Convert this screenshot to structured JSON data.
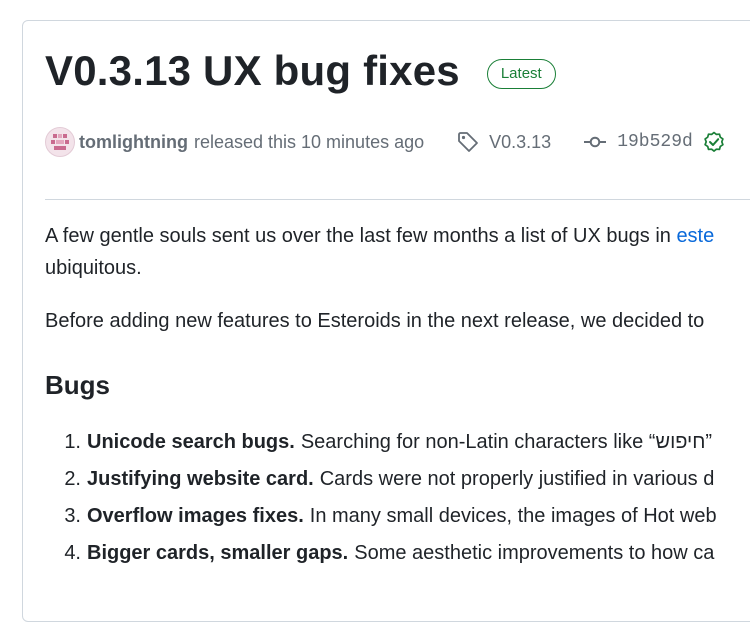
{
  "release": {
    "title": "V0.3.13 UX bug fixes",
    "badge": "Latest",
    "author": "tomlightning",
    "released_text": "released this 10 minutes ago",
    "tag": "V0.3.13",
    "commit_sha": "19b529d",
    "verified_icon": "verified-check-icon",
    "colors": {
      "badge_green": "#1a7f37",
      "link_blue": "#0969da",
      "muted": "#656d76",
      "border": "#d0d7de"
    }
  },
  "body": {
    "paragraph1_start": "A few gentle souls sent us over the last few months a list of UX bugs in ",
    "paragraph1_link": "este",
    "paragraph1_line2": "ubiquitous.",
    "paragraph2": "Before adding new features to Esteroids in the next release, we decided to",
    "bugs_heading": "Bugs",
    "bugs": [
      {
        "num": "1.",
        "title": "Unicode search bugs.",
        "text": "Searching for non-Latin characters like “‎חיפוש”"
      },
      {
        "num": "2.",
        "title": "Justifying website card.",
        "text": "Cards were not properly justified in various d"
      },
      {
        "num": "3.",
        "title": "Overflow images fixes.",
        "text": "In many small devices, the images of Hot web"
      },
      {
        "num": "4.",
        "title": "Bigger cards, smaller gaps.",
        "text": "Some aesthetic improvements to how ca"
      }
    ]
  }
}
